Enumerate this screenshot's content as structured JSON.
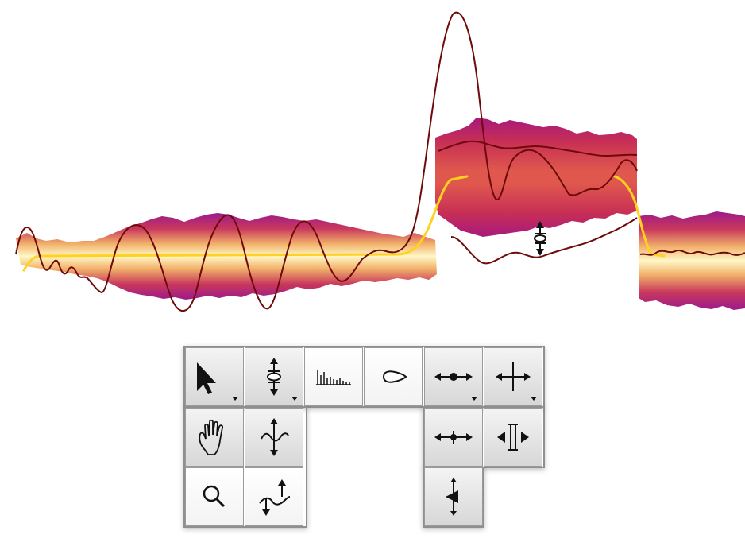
{
  "colors": {
    "blob_core": "#fff7c8",
    "blob_mid": "#f2b36b",
    "blob_outer": "#c9385c",
    "blob_edge": "#9c1a8c",
    "pitch_curve": "#6e0a0a",
    "yellow_curve": "#ffd21f",
    "button_border": "#9a9a9a",
    "button_light": "#ffffff",
    "button_dark": "#d7d7d7",
    "icon": "#111111"
  },
  "blobs": [
    {
      "name": "note-blob-1",
      "selected": false
    },
    {
      "name": "note-blob-2",
      "selected": true
    },
    {
      "name": "note-blob-3",
      "selected": false
    }
  ],
  "cursor": {
    "icon": "pitch-move-cursor-icon"
  },
  "tools": {
    "main_tool": {
      "icon": "arrow-pointer-icon",
      "has_submenu": true
    },
    "pitch_tool": {
      "icon": "pitch-tool-icon",
      "has_submenu": true
    },
    "amplitude_tool": {
      "icon": "amplitude-bars-icon",
      "has_submenu": false
    },
    "formant_tool": {
      "icon": "formant-blob-icon",
      "has_submenu": false
    },
    "time_tool": {
      "icon": "time-stretch-icon",
      "has_submenu": true
    },
    "separation_tool": {
      "icon": "note-separation-icon",
      "has_submenu": true
    },
    "scroll_tool": {
      "icon": "hand-icon",
      "has_submenu": false
    },
    "pitch_modulation_tool": {
      "icon": "pitch-modulation-icon",
      "has_submenu": false
    },
    "zoom_tool": {
      "icon": "magnifier-icon",
      "has_submenu": false
    },
    "pitch_drift_tool": {
      "icon": "pitch-drift-icon",
      "has_submenu": false
    },
    "move_time_tool": {
      "icon": "move-time-icon",
      "has_submenu": false
    },
    "separation_edit_tool": {
      "icon": "separation-edit-icon",
      "has_submenu": false
    },
    "attack_speed_tool": {
      "icon": "attack-speed-icon",
      "has_submenu": false
    }
  }
}
